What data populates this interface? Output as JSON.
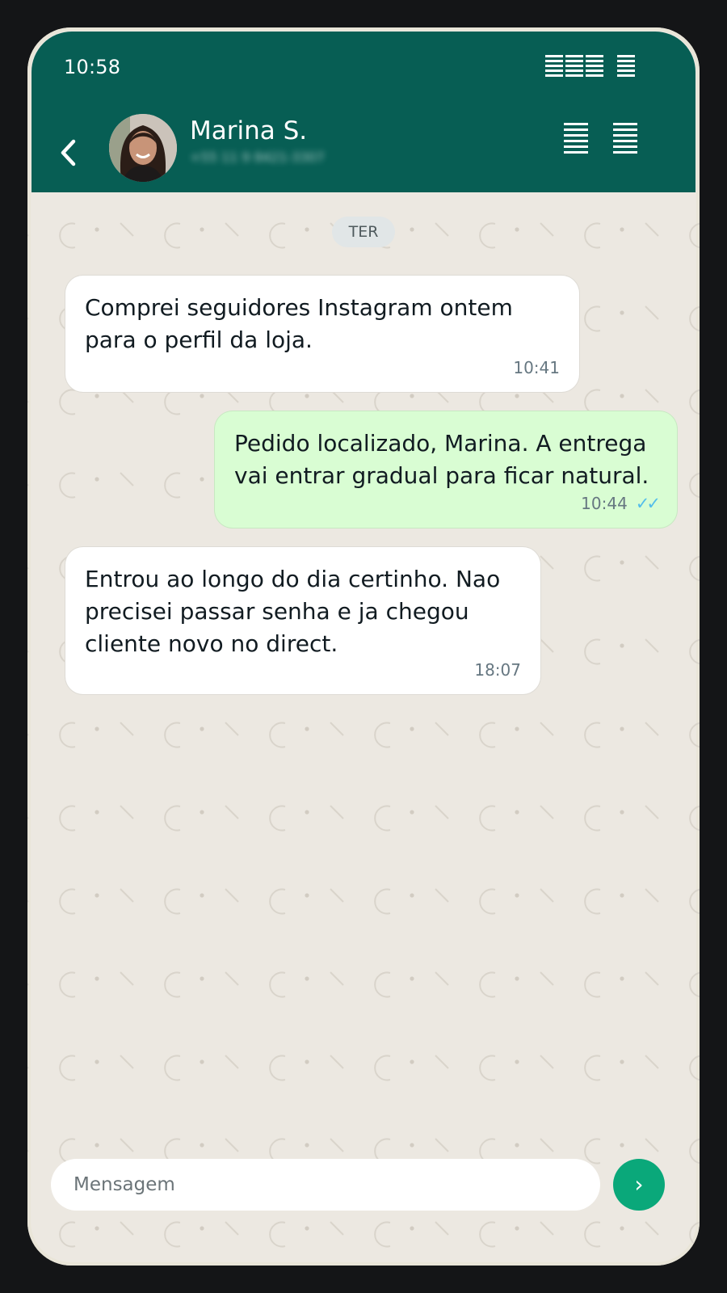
{
  "status_bar": {
    "time": "10:58",
    "icons": [
      "signal-icon",
      "battery-icon"
    ]
  },
  "header": {
    "back_icon": "chevron-left-icon",
    "contact_name": "Marina S.",
    "contact_subtitle": "+55 11 9 8421-3307",
    "actions": [
      "video-call-icon",
      "phone-call-icon"
    ],
    "color": "#075e54"
  },
  "chat": {
    "date_label": "TER",
    "messages": [
      {
        "direction": "in",
        "text": "Comprei seguidores Instagram ontem para o perfil da loja.",
        "time": "10:41"
      },
      {
        "direction": "out",
        "text": "Pedido localizado, Marina. A entrega vai entrar gradual para ficar natural.",
        "time": "10:44",
        "status": "read",
        "status_icon": "double-check-icon"
      },
      {
        "direction": "in",
        "text": "Entrou ao longo do dia certinho. Nao precisei passar senha e ja chegou cliente novo no direct.",
        "time": "18:07"
      }
    ],
    "background": "#ece8e1",
    "incoming_bubble": "#ffffff",
    "outgoing_bubble": "#d9fdd3"
  },
  "composer": {
    "placeholder": "Mensagem",
    "value": "",
    "send_icon": "send-chevron-icon",
    "send_glyph": "›",
    "send_color": "#0aa87a"
  }
}
